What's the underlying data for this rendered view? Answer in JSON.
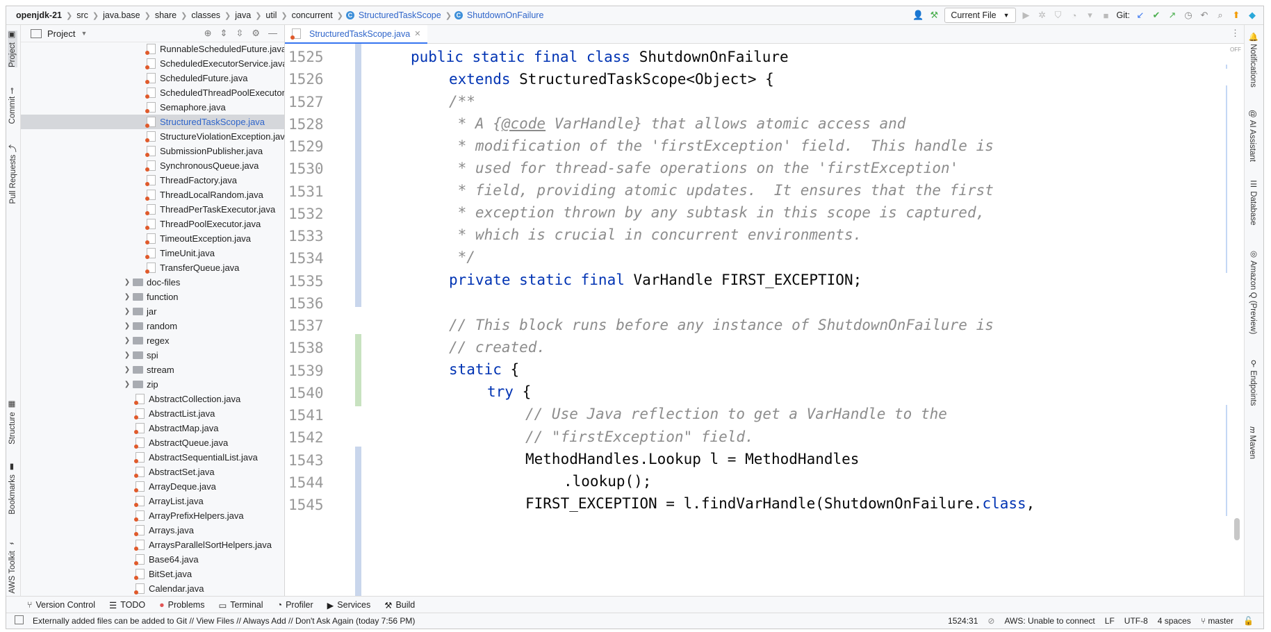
{
  "breadcrumb": {
    "project": "openjdk-21",
    "parts": [
      "src",
      "java.base",
      "share",
      "classes",
      "java",
      "util",
      "concurrent"
    ],
    "class1": "StructuredTaskScope",
    "class2": "ShutdownOnFailure"
  },
  "toolbar": {
    "run_config": "Current File",
    "git_label": "Git:"
  },
  "left_stripe": {
    "project": "Project",
    "commit": "Commit",
    "pull_requests": "Pull Requests",
    "structure": "Structure",
    "bookmarks": "Bookmarks",
    "aws_toolkit": "AWS Toolkit"
  },
  "right_stripe": {
    "notifications": "Notifications",
    "ai_assistant": "AI Assistant",
    "database": "Database",
    "amazon_q": "Amazon Q (Preview)",
    "endpoints": "Endpoints",
    "maven": "Maven"
  },
  "project_panel": {
    "title": "Project",
    "files_top": [
      "RunnableScheduledFuture.java",
      "ScheduledExecutorService.java",
      "ScheduledFuture.java",
      "ScheduledThreadPoolExecutor.java",
      "Semaphore.java",
      "StructuredTaskScope.java",
      "StructureViolationException.java",
      "SubmissionPublisher.java",
      "SynchronousQueue.java",
      "ThreadFactory.java",
      "ThreadLocalRandom.java",
      "ThreadPerTaskExecutor.java",
      "ThreadPoolExecutor.java",
      "TimeoutException.java",
      "TimeUnit.java",
      "TransferQueue.java"
    ],
    "folders": [
      "doc-files",
      "function",
      "jar",
      "random",
      "regex",
      "spi",
      "stream",
      "zip"
    ],
    "files_bottom": [
      "AbstractCollection.java",
      "AbstractList.java",
      "AbstractMap.java",
      "AbstractQueue.java",
      "AbstractSequentialList.java",
      "AbstractSet.java",
      "ArrayDeque.java",
      "ArrayList.java",
      "ArrayPrefixHelpers.java",
      "Arrays.java",
      "ArraysParallelSortHelpers.java",
      "Base64.java",
      "BitSet.java",
      "Calendar.java"
    ]
  },
  "editor": {
    "tab": "StructuredTaskScope.java",
    "off_label": "OFF",
    "line_numbers": [
      "1525",
      "1526",
      "1527",
      "1528",
      "1529",
      "1530",
      "1531",
      "1532",
      "1533",
      "1534",
      "1535",
      "1536",
      "1537",
      "1538",
      "1539",
      "1540",
      "1541",
      "1542",
      "1543",
      "1544",
      "1545"
    ],
    "code": {
      "l1525_kw": "public static final class",
      "l1525_rest": " ShutdownOnFailure",
      "l1526_kw": "extends",
      "l1526_rest": " StructuredTaskScope<Object> {",
      "l1527": "/**",
      "l1528_a": " * A {",
      "l1528_code": "@code",
      "l1528_b": " VarHandle} that allows atomic access and",
      "l1529": " * modification of the 'firstException' field.  This handle is",
      "l1530": " * used for thread-safe operations on the 'firstException'",
      "l1531": " * field, providing atomic updates.  It ensures that the first",
      "l1532": " * exception thrown by any subtask in this scope is captured,",
      "l1533": " * which is crucial in concurrent environments.",
      "l1534": " */",
      "l1535_kw": "private static final",
      "l1535_rest": " VarHandle FIRST_EXCEPTION;",
      "l1537": "// This block runs before any instance of ShutdownOnFailure is",
      "l1538": "// created.",
      "l1539_kw": "static",
      "l1539_rest": " {",
      "l1540_kw": "try",
      "l1540_rest": " {",
      "l1541": "// Use Java reflection to get a VarHandle to the",
      "l1542": "// \"firstException\" field.",
      "l1543": "MethodHandles.Lookup l = MethodHandles",
      "l1544": ".lookup();",
      "l1545_a": "FIRST_EXCEPTION = l.findVarHandle(ShutdownOnFailure.",
      "l1545_kw": "class",
      "l1545_b": ","
    }
  },
  "bottom_tools": [
    "Version Control",
    "TODO",
    "Problems",
    "Terminal",
    "Profiler",
    "Services",
    "Build"
  ],
  "status": {
    "message": "Externally added files can be added to Git // View Files // Always Add // Don't Ask Again (today 7:56 PM)",
    "position": "1524:31",
    "aws": "AWS: Unable to connect",
    "line_sep": "LF",
    "encoding": "UTF-8",
    "indent": "4 spaces",
    "branch": "master"
  },
  "colors": {
    "keyword": "#0033b3",
    "comment": "#8c8c8c",
    "link": "#2f65ca",
    "selection": "#d5d7db",
    "vcs_modified": "#c9d6ec",
    "vcs_added": "#c8e2c0"
  }
}
